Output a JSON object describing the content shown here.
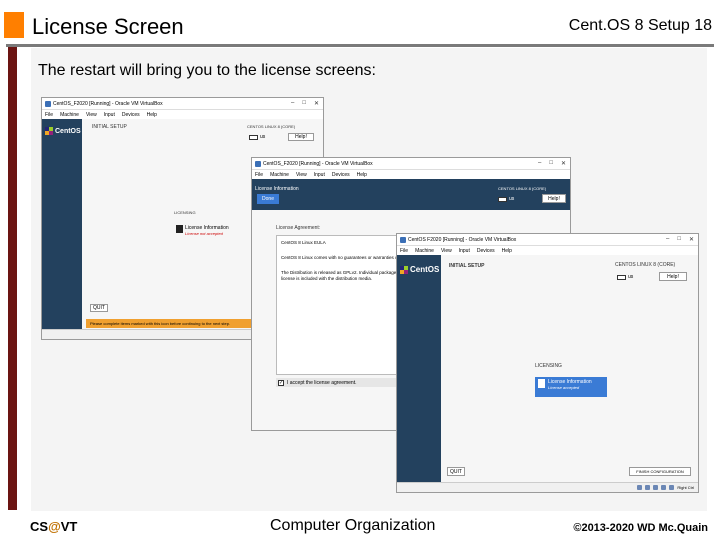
{
  "slide": {
    "title": "License Screen",
    "header_right": "Cent.OS 8 Setup  18",
    "bullet": "The restart will bring you to the license screens:",
    "footer_left_a": "CS",
    "footer_left_at": "@",
    "footer_left_b": "VT",
    "footer_center": "Computer Organization",
    "footer_right": "©2013-2020 WD Mc.Quain"
  },
  "vm_menu": [
    "File",
    "Machine",
    "View",
    "Input",
    "Devices",
    "Help"
  ],
  "vm1": {
    "title": "CentOS_F2020 [Running] - Oracle VM VirtualBox",
    "header": "INITIAL SETUP",
    "product": "CENTOS LINUX 8 (CORE)",
    "help": "Help!",
    "kb": "us",
    "section": "LICENSING",
    "spoke_title": "License Information",
    "spoke_sub": "License not accepted",
    "quit": "QUIT",
    "warning": "Please complete items marked with this icon before continuing to the next step."
  },
  "vm2": {
    "title": "CentOS_F2020 [Running] - Oracle VM VirtualBox",
    "header": "License Information",
    "product": "CENTOS LINUX 8 (CORE)",
    "done": "Done",
    "help": "Help!",
    "kb": "us",
    "agreement_label": "License Agreement:",
    "eula": "CentOS 8 Linux EULA",
    "para1": "CentOS 8 Linux comes with no guarantees or warranties of any sorts, either written or implied.",
    "para2": "The Distribution is released as GPLv2. Individual packages in the distribution come with their own licences. A copy of the GPLv2 license is included with the distribution media.",
    "accept": "I accept the license agreement."
  },
  "vm3": {
    "title": "CentOS F2020 [Running] - Oracle VM VirtualBox",
    "header": "INITIAL SETUP",
    "product": "CENTOS LINUX 8 (CORE)",
    "help": "Help!",
    "kb": "us",
    "section": "LICENSING",
    "spoke_title": "License Information",
    "spoke_sub": "License accepted",
    "quit": "QUIT",
    "finish": "FINISH CONFIGURATION",
    "right_ctrl": "Right Ctrl"
  }
}
